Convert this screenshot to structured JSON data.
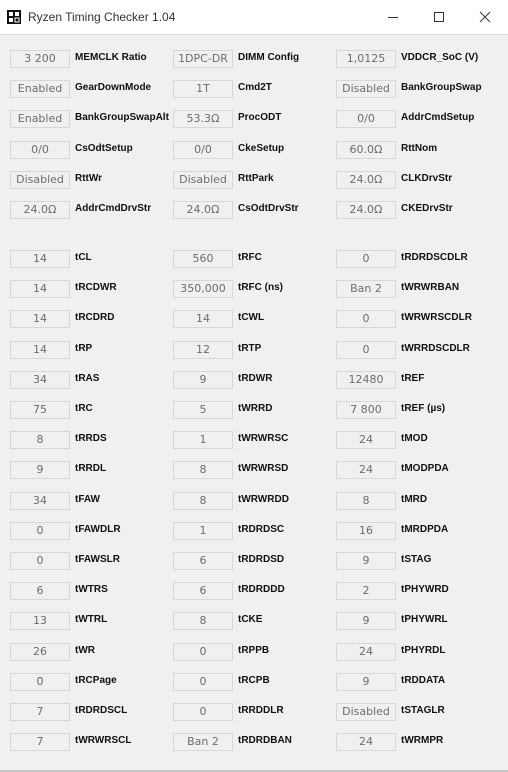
{
  "window": {
    "title": "Ryzen Timing Checker 1.04"
  },
  "icons": {
    "app": "app-grid-icon",
    "minimize": "minimize-icon",
    "maximize": "maximize-icon",
    "close": "close-icon"
  },
  "groups": [
    {
      "rows": [
        [
          {
            "value": "3 200",
            "label": "MEMCLK Ratio"
          },
          {
            "value": "1DPC-DR",
            "label": "DIMM Config"
          },
          {
            "value": "1,0125",
            "label": "VDDCR_SoC (V)"
          }
        ],
        [
          {
            "value": "Enabled",
            "label": "GearDownMode"
          },
          {
            "value": "1T",
            "label": "Cmd2T"
          },
          {
            "value": "Disabled",
            "label": "BankGroupSwap"
          }
        ],
        [
          {
            "value": "Enabled",
            "label": "BankGroupSwapAlt"
          },
          {
            "value": "53.3Ω",
            "label": "ProcODT"
          },
          {
            "value": "0/0",
            "label": "AddrCmdSetup"
          }
        ],
        [
          {
            "value": "0/0",
            "label": "CsOdtSetup"
          },
          {
            "value": "0/0",
            "label": "CkeSetup"
          },
          {
            "value": "60.0Ω",
            "label": "RttNom"
          }
        ],
        [
          {
            "value": "Disabled",
            "label": "RttWr"
          },
          {
            "value": "Disabled",
            "label": "RttPark"
          },
          {
            "value": "24.0Ω",
            "label": "CLKDrvStr"
          }
        ],
        [
          {
            "value": "24.0Ω",
            "label": "AddrCmdDrvStr"
          },
          {
            "value": "24.0Ω",
            "label": "CsOdtDrvStr"
          },
          {
            "value": "24.0Ω",
            "label": "CKEDrvStr"
          }
        ]
      ]
    },
    {
      "rows": [
        [
          {
            "value": "14",
            "label": "tCL"
          },
          {
            "value": "560",
            "label": "tRFC"
          },
          {
            "value": "0",
            "label": "tRDRDSCDLR"
          }
        ],
        [
          {
            "value": "14",
            "label": "tRCDWR"
          },
          {
            "value": "350,000",
            "label": "tRFC (ns)"
          },
          {
            "value": "Ban 2",
            "label": "tWRWRBAN"
          }
        ],
        [
          {
            "value": "14",
            "label": "tRCDRD"
          },
          {
            "value": "14",
            "label": "tCWL"
          },
          {
            "value": "0",
            "label": "tWRWRSCDLR"
          }
        ],
        [
          {
            "value": "14",
            "label": "tRP"
          },
          {
            "value": "12",
            "label": "tRTP"
          },
          {
            "value": "0",
            "label": "tWRRDSCDLR"
          }
        ],
        [
          {
            "value": "34",
            "label": "tRAS"
          },
          {
            "value": "9",
            "label": "tRDWR"
          },
          {
            "value": "12480",
            "label": "tREF"
          }
        ],
        [
          {
            "value": "75",
            "label": "tRC"
          },
          {
            "value": "5",
            "label": "tWRRD"
          },
          {
            "value": "7 800",
            "label": "tREF (µs)"
          }
        ],
        [
          {
            "value": "8",
            "label": "tRRDS"
          },
          {
            "value": "1",
            "label": "tWRWRSC"
          },
          {
            "value": "24",
            "label": "tMOD"
          }
        ],
        [
          {
            "value": "9",
            "label": "tRRDL"
          },
          {
            "value": "8",
            "label": "tWRWRSD"
          },
          {
            "value": "24",
            "label": "tMODPDA"
          }
        ],
        [
          {
            "value": "34",
            "label": "tFAW"
          },
          {
            "value": "8",
            "label": "tWRWRDD"
          },
          {
            "value": "8",
            "label": "tMRD"
          }
        ],
        [
          {
            "value": "0",
            "label": "tFAWDLR"
          },
          {
            "value": "1",
            "label": "tRDRDSC"
          },
          {
            "value": "16",
            "label": "tMRDPDA"
          }
        ],
        [
          {
            "value": "0",
            "label": "tFAWSLR"
          },
          {
            "value": "6",
            "label": "tRDRDSD"
          },
          {
            "value": "9",
            "label": "tSTAG"
          }
        ],
        [
          {
            "value": "6",
            "label": "tWTRS"
          },
          {
            "value": "6",
            "label": "tRDRDDD"
          },
          {
            "value": "2",
            "label": "tPHYWRD"
          }
        ],
        [
          {
            "value": "13",
            "label": "tWTRL"
          },
          {
            "value": "8",
            "label": "tCKE"
          },
          {
            "value": "9",
            "label": "tPHYWRL"
          }
        ],
        [
          {
            "value": "26",
            "label": "tWR"
          },
          {
            "value": "0",
            "label": "tRPPB"
          },
          {
            "value": "24",
            "label": "tPHYRDL"
          }
        ],
        [
          {
            "value": "0",
            "label": "tRCPage"
          },
          {
            "value": "0",
            "label": "tRCPB"
          },
          {
            "value": "9",
            "label": "tRDDATA"
          }
        ],
        [
          {
            "value": "7",
            "label": "tRDRDSCL"
          },
          {
            "value": "0",
            "label": "tRRDDLR"
          },
          {
            "value": "Disabled",
            "label": "tSTAGLR"
          }
        ],
        [
          {
            "value": "7",
            "label": "tWRWRSCL"
          },
          {
            "value": "Ban 2",
            "label": "tRDRDBAN"
          },
          {
            "value": "24",
            "label": "tWRMPR"
          }
        ]
      ]
    }
  ]
}
